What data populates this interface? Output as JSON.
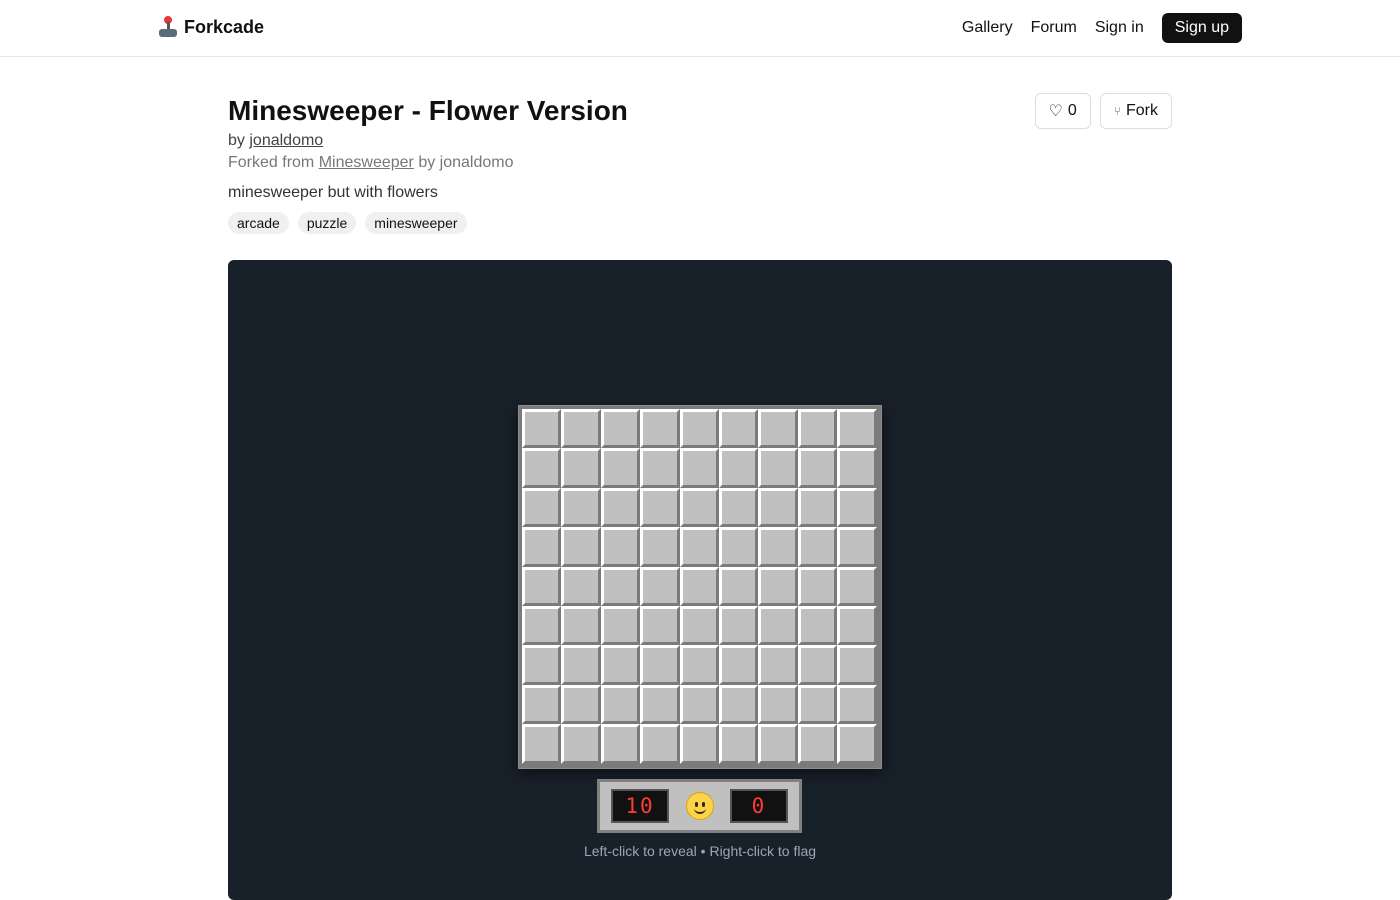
{
  "nav": {
    "brand": "Forkcade",
    "brand_icon": "joystick-icon",
    "links": {
      "gallery": "Gallery",
      "forum": "Forum",
      "signin": "Sign in",
      "signup": "Sign up"
    }
  },
  "game": {
    "title": "Minesweeper - Flower Version",
    "by_prefix": "by",
    "author": "jonaldomo",
    "forked_prefix": "Forked from",
    "forked_from": "Minesweeper",
    "forked_by": "by jonaldomo",
    "description": "minesweeper but with flowers",
    "tags": [
      "arcade",
      "puzzle",
      "minesweeper"
    ],
    "likes": "0",
    "like_icon": "heart-icon",
    "fork_label": "Fork",
    "fork_icon": "fork-icon"
  },
  "board": {
    "rows": 9,
    "cols": 9,
    "mines_left": "10",
    "timer": "0",
    "face": "smiley-icon",
    "hint": "Left-click to reveal • Right-click to flag"
  },
  "colors": {
    "panel_bg": "#18202a",
    "cell": "#c0c0c0",
    "lcd_text": "#ff3b30",
    "signup_bg": "#111111"
  }
}
